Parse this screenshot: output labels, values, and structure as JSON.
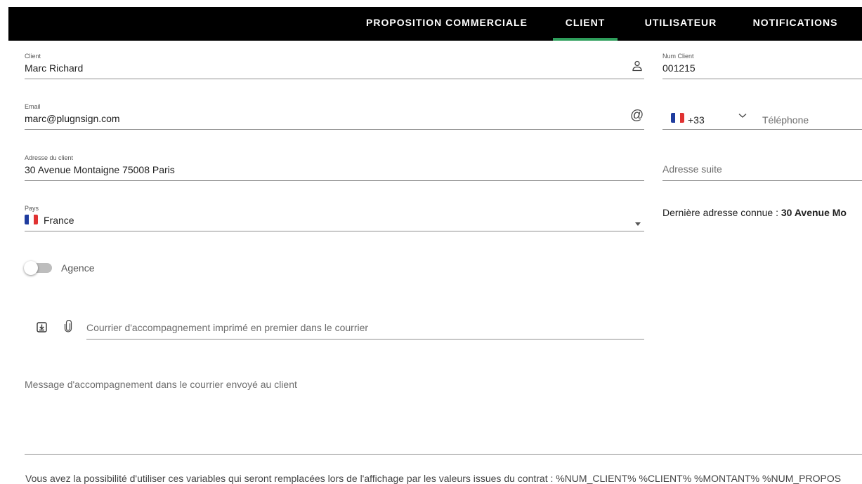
{
  "tabs": [
    {
      "label": "PROPOSITION COMMERCIALE",
      "active": false
    },
    {
      "label": "CLIENT",
      "active": true
    },
    {
      "label": "UTILISATEUR",
      "active": false
    },
    {
      "label": "NOTIFICATIONS",
      "active": false
    }
  ],
  "colors": {
    "accent": "#2e9e5b",
    "header_bg": "#000000",
    "flag": [
      "#1f3c9e",
      "#ffffff",
      "#e03232"
    ]
  },
  "client": {
    "label": "Client",
    "value": "Marc Richard",
    "icon": "person-icon"
  },
  "num_client": {
    "label": "Num Client",
    "value": "001215"
  },
  "email": {
    "label": "Email",
    "value": "marc@plugnsign.com",
    "icon": "at-sign-icon"
  },
  "phone": {
    "country_code": "+33",
    "placeholder": "Téléphone",
    "flag": "france-flag-icon"
  },
  "address": {
    "label": "Adresse du client",
    "value": "30 Avenue Montaigne 75008 Paris"
  },
  "address_suite": {
    "placeholder": "Adresse suite"
  },
  "country": {
    "label": "Pays",
    "value": "France",
    "flag": "france-flag-icon"
  },
  "last_address": {
    "prefix": "Dernière adresse connue : ",
    "value": "30 Avenue Mo"
  },
  "agency": {
    "label": "Agence",
    "enabled": false
  },
  "cover_letter": {
    "placeholder": "Courrier d'accompagnement imprimé en premier dans le courrier"
  },
  "message": {
    "placeholder": "Message d'accompagnement dans le courrier envoyé au client"
  },
  "footer": {
    "text": "Vous avez la possibilité d'utiliser ces variables qui seront remplacées lors de l'affichage par les valeurs issues du contrat : %NUM_CLIENT% %CLIENT% %MONTANT% %NUM_PROPOS"
  }
}
